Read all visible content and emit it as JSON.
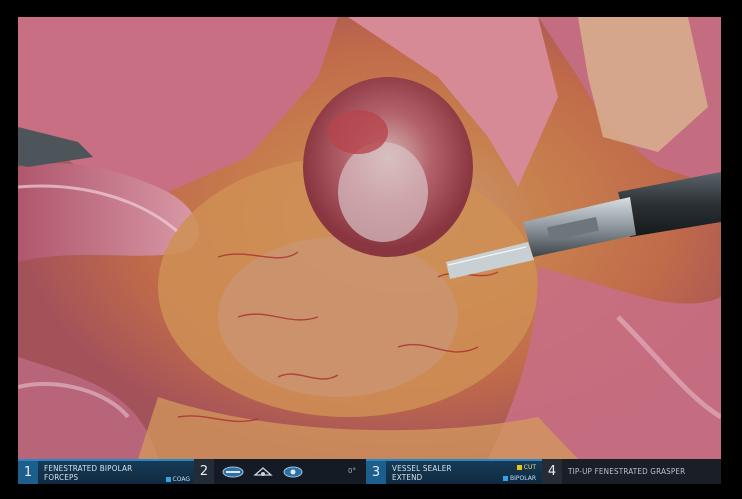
{
  "arms": [
    {
      "number": "1",
      "instrument": [
        "FENESTRATED BIPOLAR",
        "FORCEPS"
      ],
      "energy": "COAG",
      "energy_color": "#3aa0e0"
    },
    {
      "number": "2",
      "instrument": [
        "",
        ""
      ],
      "camera_angle": "0°",
      "camera_icons": [
        "scope-icon",
        "light-icon",
        "zoom-icon"
      ]
    },
    {
      "number": "3",
      "instrument": [
        "VESSEL SEALER",
        "EXTEND"
      ],
      "energy_modes": [
        {
          "label": "CUT",
          "color": "#e6c21a"
        },
        {
          "label": "BIPOLAR",
          "color": "#3aa0e0"
        }
      ]
    },
    {
      "number": "4",
      "instrument": [
        "TIP-UP FENESTRATED GRASPER",
        ""
      ]
    }
  ],
  "colors": {
    "active_arm_bg": "#173b57",
    "active_arm_border": "#2a86c4",
    "inactive_arm_bg": "#151b24"
  }
}
